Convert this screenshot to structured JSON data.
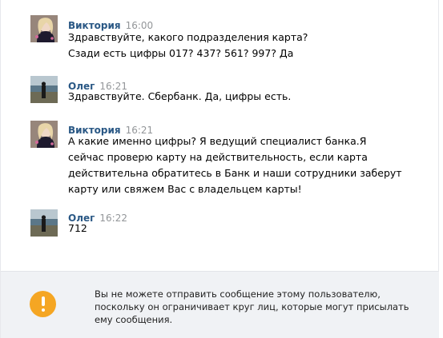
{
  "messages": [
    {
      "author": "Виктория",
      "time": "16:00",
      "avatar_icon": "avatar-viktoria-photo",
      "lines": [
        "Здравствуйте, какого подразделения карта?",
        "Сзади есть цифры 017? 437? 561? 997? Да"
      ]
    },
    {
      "author": "Олег",
      "time": "16:21",
      "avatar_icon": "avatar-oleg-photo",
      "lines": [
        "Здравствуйте. Сбербанк. Да, цифры есть."
      ]
    },
    {
      "author": "Виктория",
      "time": "16:21",
      "avatar_icon": "avatar-viktoria-photo",
      "lines": [
        "А какие именно цифры? Я ведущий специалист банка.Я",
        "сейчас проверю карту на действительность, если карта",
        "действительна обратитесь в Банк и наши сотрудники заберут",
        "карту или свяжем Вас с владельцем карты!"
      ]
    },
    {
      "author": "Олег",
      "time": "16:22",
      "avatar_icon": "avatar-oleg-photo",
      "lines": [
        "712"
      ]
    }
  ],
  "notice": {
    "icon": "warning-icon",
    "color": "#f5a623",
    "lines": [
      "Вы не можете отправить сообщение этому пользователю,",
      "поскольку он ограничивает круг лиц, которые могут присылать",
      "ему сообщения."
    ]
  },
  "colors": {
    "author": "#2a5885",
    "time": "#939699",
    "notice_bg": "#f0f2f5"
  }
}
